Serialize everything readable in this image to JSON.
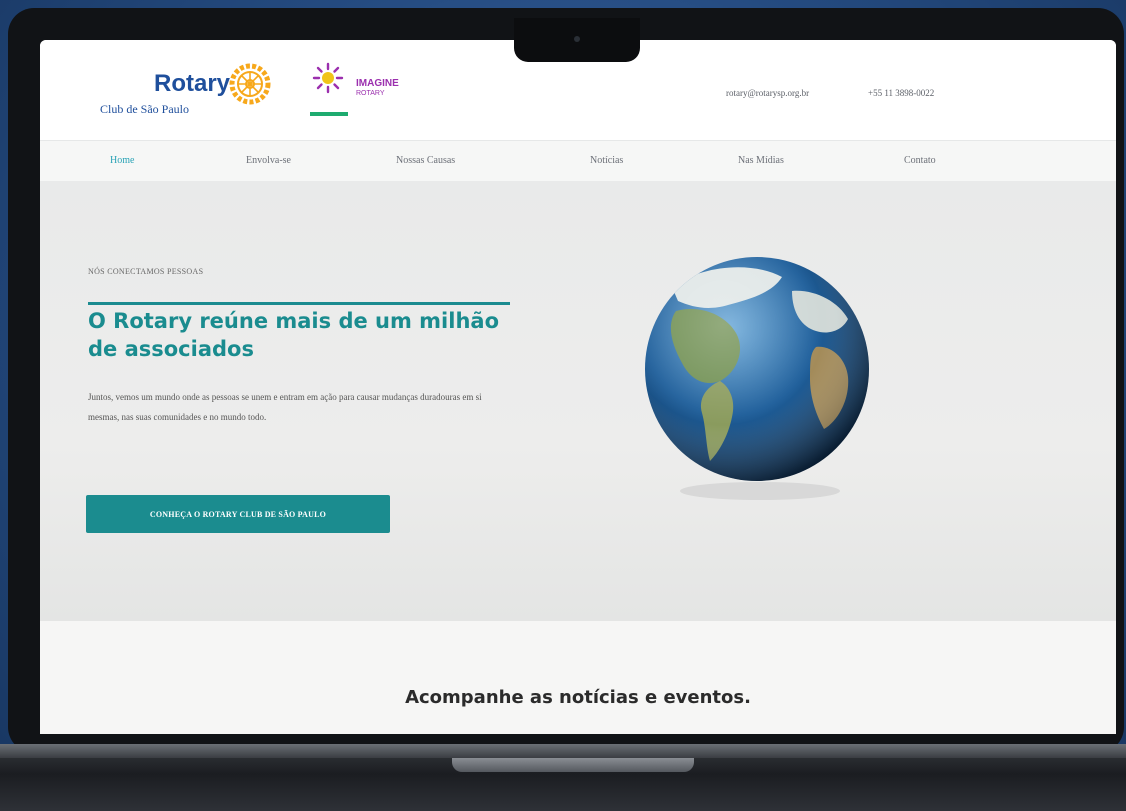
{
  "header": {
    "logo": {
      "name": "Rotary",
      "subtitle": "Club de São Paulo"
    },
    "campaign": {
      "title": "IMAGINE",
      "subtitle": "ROTARY"
    },
    "contact": {
      "email": "rotary@rotarysp.org.br",
      "phone": "+55 11 3898-0022"
    }
  },
  "nav": {
    "items": [
      {
        "label": "Home",
        "active": true
      },
      {
        "label": "Envolva-se",
        "active": false
      },
      {
        "label": "Nossas Causas",
        "active": false
      },
      {
        "label": "Notícias",
        "active": false
      },
      {
        "label": "Nas Mídias",
        "active": false
      },
      {
        "label": "Contato",
        "active": false
      }
    ]
  },
  "hero": {
    "kicker": "NÓS CONECTAMOS PESSOAS",
    "title": "O Rotary reúne mais de um milhão de associados",
    "body": "Juntos, vemos um mundo onde as pessoas se unem e entram em ação para causar mudanças duradouras em si mesmas, nas suas comunidades e no mundo todo.",
    "cta_label": "CONHEÇA O ROTARY CLUB DE SÃO PAULO"
  },
  "news": {
    "title": "Acompanhe as notícias e eventos."
  },
  "colors": {
    "brand_blue": "#1f4f9c",
    "rotary_gold": "#f7a81b",
    "accent_teal": "#1b8c8f",
    "nav_active": "#2aa3b6",
    "imagine_purple": "#9b2fae",
    "imagine_green": "#1eab6f"
  }
}
